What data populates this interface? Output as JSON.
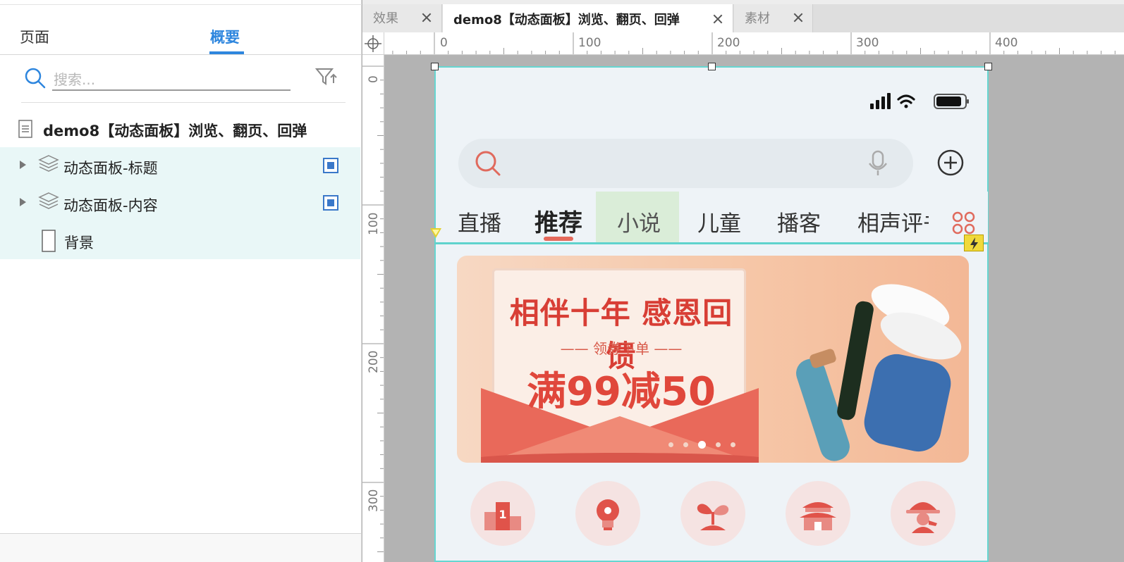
{
  "left_panel": {
    "tab_pages": "页面",
    "tab_outline": "概要",
    "search_placeholder": "搜索...",
    "tree": {
      "page_title": "demo8【动态面板】浏览、翻页、回弹",
      "items": [
        {
          "label": "动态面板-标题",
          "type": "dynamic-panel"
        },
        {
          "label": "动态面板-内容",
          "type": "dynamic-panel"
        },
        {
          "label": "背景",
          "type": "rectangle"
        }
      ]
    }
  },
  "doc_tabs": [
    {
      "label": "效果",
      "active": false
    },
    {
      "label": "demo8【动态面板】浏览、翻页、回弹",
      "active": true
    },
    {
      "label": "素材",
      "active": false
    }
  ],
  "ruler": {
    "h_labels": [
      "0",
      "100",
      "200",
      "300",
      "400"
    ],
    "v_labels": [
      "0",
      "100",
      "200",
      "300"
    ]
  },
  "phone": {
    "nav_tabs": [
      "直播",
      "推荐",
      "小说",
      "儿童",
      "播客",
      "相声评书"
    ],
    "active_tab": "推荐",
    "banner": {
      "title": "相伴十年 感恩回馈",
      "subtitle": "—— 领券下单 ——",
      "offer": "满99减50",
      "page_index": 3,
      "page_count": 5
    },
    "categories": [
      "podium-icon",
      "lightbulb-icon",
      "sprout-icon",
      "temple-icon",
      "detective-icon"
    ]
  },
  "colors": {
    "accent_blue": "#2e86de",
    "selection_teal": "#66d6d1",
    "banner_red": "#d83e35"
  }
}
